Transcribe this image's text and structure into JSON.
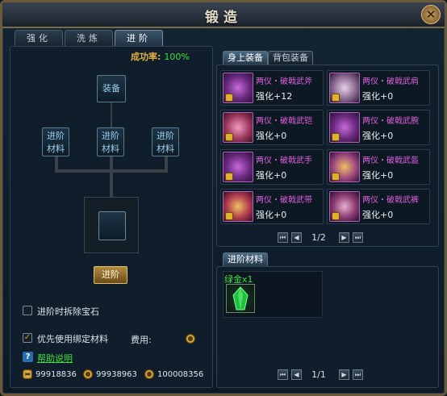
{
  "window": {
    "title": "锻造",
    "close_label": "✕"
  },
  "tabs": [
    {
      "label": "强化"
    },
    {
      "label": "洗炼"
    },
    {
      "label": "进阶"
    }
  ],
  "success_rate": {
    "label": "成功率:",
    "value": "100%"
  },
  "forge": {
    "equip_slot": "装备",
    "materials": [
      {
        "line1": "进阶",
        "line2": "材料"
      },
      {
        "line1": "进阶",
        "line2": "材料"
      },
      {
        "line1": "进阶",
        "line2": "材料"
      }
    ],
    "advance_button": "进阶",
    "remove_gem_label": "进阶时拆除宝石",
    "prefer_bound_label": "优先使用绑定材料",
    "cost_label": "费用:",
    "help_label": "帮助说明",
    "currency": [
      "99918836",
      "99938963",
      "100008356"
    ]
  },
  "equipment_tabs": [
    {
      "label": "身上装备"
    },
    {
      "label": "背包装备"
    }
  ],
  "items": [
    {
      "name": "两仪・破戟武斧",
      "level": "强化+12"
    },
    {
      "name": "两仪・破戟武肩",
      "level": "强化+0"
    },
    {
      "name": "两仪・破戟武铠",
      "level": "强化+0"
    },
    {
      "name": "两仪・破戟武腕",
      "level": "强化+0"
    },
    {
      "name": "两仪・破戟武手",
      "level": "强化+0"
    },
    {
      "name": "两仪・破戟武盔",
      "level": "强化+0"
    },
    {
      "name": "两仪・破戟武带",
      "level": "强化+0"
    },
    {
      "name": "两仪・破戟武裤",
      "level": "强化+0"
    }
  ],
  "equip_pager": {
    "text": "1/2"
  },
  "materials_panel": {
    "tab_label": "进阶材料",
    "material_name": "绿金x1",
    "pager": "1/1"
  },
  "colors": {
    "accent": "#e0b040",
    "success": "#40e040",
    "item_name": "#e060e0"
  },
  "icons": {
    "pager_first": "⏮",
    "pager_prev": "◀",
    "pager_next": "▶",
    "pager_last": "⏭"
  }
}
